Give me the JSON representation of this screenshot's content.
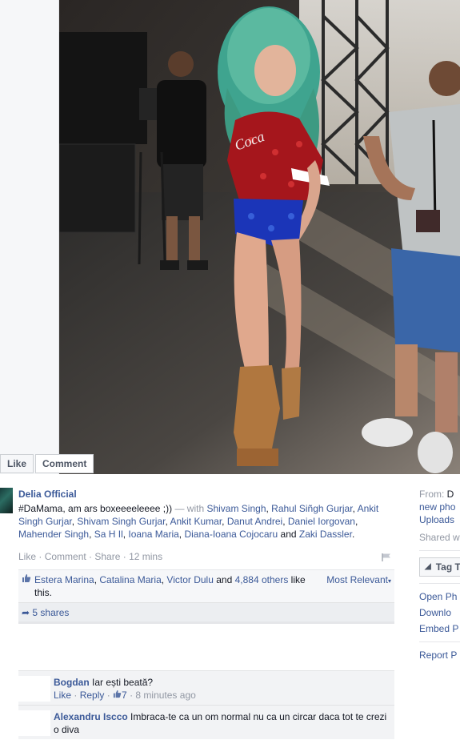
{
  "action_bar": {
    "like": "Like",
    "comment": "Comment"
  },
  "post": {
    "author": "Delia Official",
    "text_main": "#DaMama, am ars boxeeeeleeee ;)) ",
    "text_with": "— with ",
    "tagged": [
      "Shivam Singh",
      "Rahul Siñgh Gurjar",
      "Ankit Singh Gurjar",
      "Shivam Singh Gurjar",
      "Ankit Kumar",
      "Danut Andrei",
      "Daniel Iorgovan",
      "Mahender Singh",
      "Sa H Il",
      "Ioana Maria",
      "Diana-Ioana Cojocaru"
    ],
    "and_word": " and ",
    "last_tagged": "Zaki Dassler",
    "end": ".",
    "meta": {
      "like": "Like",
      "comment": "Comment",
      "share": "Share",
      "time": "12 mins"
    }
  },
  "likes": {
    "names": [
      "Estera Marina",
      "Catalina Maria",
      "Victor Dulu"
    ],
    "and_word": " and ",
    "others": "4,884 others",
    "suffix": " like this.",
    "sort": "Most Relevant"
  },
  "shares": "5 shares",
  "comments": [
    {
      "name": "Bogdan",
      "text": "Iar ești beată?",
      "reply": "Reply",
      "like": "Like",
      "likes_count": "7",
      "time": "8 minutes ago"
    },
    {
      "name": "Alexandru Iscco",
      "text": "Imbraca-te ca un om normal nu ca un circar daca tot te crezi o diva"
    }
  ],
  "right_col": {
    "from_label": "From: ",
    "from_value": "D",
    "line2": "new pho",
    "line3": "Uploads",
    "shared": "Shared w",
    "tag": "Tag T",
    "open": "Open Ph",
    "download": "Downlo",
    "embed": "Embed P",
    "report": "Report P"
  }
}
